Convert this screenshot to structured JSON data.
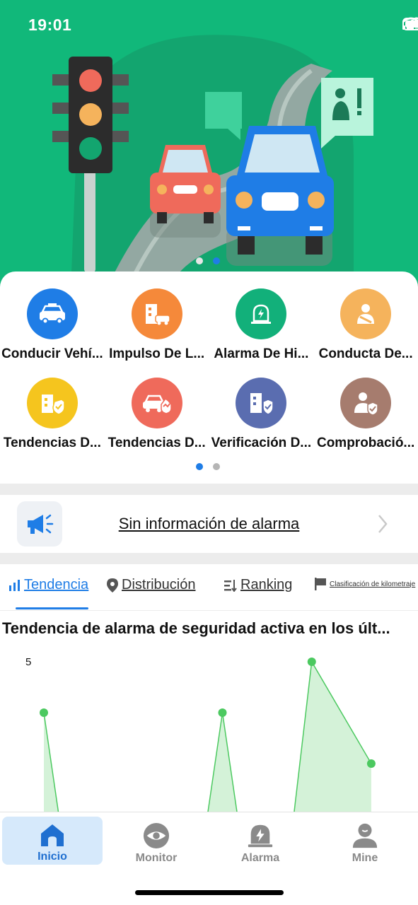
{
  "status_bar": {
    "time": "19:01",
    "icons": [
      "signal-icon",
      "wifi-icon",
      "battery-icon"
    ]
  },
  "hero": {
    "slides": 2,
    "active_slide": 2
  },
  "functions": {
    "items": [
      {
        "label": "Conducir Vehí...",
        "icon": "vehicle-icon",
        "color": "#1f7de6"
      },
      {
        "label": "Impulso De L...",
        "icon": "building-car-icon",
        "color": "#f5893a"
      },
      {
        "label": "Alarma De Hi...",
        "icon": "alarm-light-icon",
        "color": "#12b07a"
      },
      {
        "label": "Conducta De...",
        "icon": "driver-belt-icon",
        "color": "#f5b35c"
      },
      {
        "label": "Tendencias D...",
        "icon": "building-shield-icon",
        "color": "#f5c51e"
      },
      {
        "label": "Tendencias D...",
        "icon": "car-trend-icon",
        "color": "#ef6a5b"
      },
      {
        "label": "Verificación D...",
        "icon": "building-verify-icon",
        "color": "#5a6db0"
      },
      {
        "label": "Comprobació...",
        "icon": "person-check-icon",
        "color": "#a67c6e"
      }
    ],
    "pages": 2,
    "active_page": 1
  },
  "alarm_notice": {
    "text": "Sin información de alarma",
    "icon": "megaphone-icon"
  },
  "tabs": [
    {
      "label": "Tendencia",
      "icon": "bar-chart-icon",
      "active": true
    },
    {
      "label": "Distribución",
      "icon": "location-pin-icon",
      "active": false
    },
    {
      "label": "Ranking",
      "icon": "sort-icon",
      "active": false
    },
    {
      "label": "Clasificación de kilometraje",
      "icon": "flag-icon",
      "active": false
    }
  ],
  "chart": {
    "title": "Tendencia de alarma de seguridad activa en los últ..."
  },
  "chart_data": {
    "type": "area",
    "title": "Tendencia de alarma de seguridad activa en los últ...",
    "y_tick_labels": [
      "5"
    ],
    "ylim": [
      0,
      5
    ],
    "x": [
      1,
      2,
      3,
      4,
      5,
      6,
      7,
      8,
      9,
      10,
      11,
      12,
      13
    ],
    "values": [
      4,
      0,
      0,
      0,
      0,
      0,
      4,
      0,
      0,
      5,
      null,
      3
    ],
    "color": "#4cc960",
    "fill": "#d4f2d8"
  },
  "bottom_nav": [
    {
      "label": "Inicio",
      "icon": "home-icon",
      "active": true
    },
    {
      "label": "Monitor",
      "icon": "eye-icon",
      "active": false
    },
    {
      "label": "Alarma",
      "icon": "alarm-light-icon",
      "active": false
    },
    {
      "label": "Mine",
      "icon": "user-icon",
      "active": false
    }
  ]
}
